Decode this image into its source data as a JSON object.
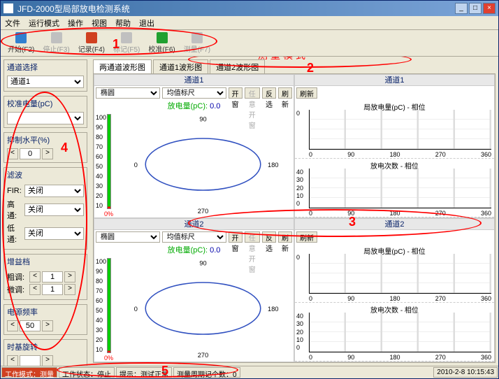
{
  "title": "JFD-2000型局部放电检测系统",
  "menu": [
    "文件",
    "运行模式",
    "操作",
    "视图",
    "帮助",
    "退出"
  ],
  "toolbar": [
    {
      "label": "开始(F2)",
      "color": "#3080d0",
      "disabled": false
    },
    {
      "label": "停止(F3)",
      "color": "#c0c0c0",
      "disabled": true
    },
    {
      "label": "记录(F4)",
      "color": "#d04020",
      "disabled": false
    },
    {
      "label": "标记(F5)",
      "color": "#c0c0c0",
      "disabled": true
    },
    {
      "label": "校准(F6)",
      "color": "#20a030",
      "disabled": false
    },
    {
      "label": "测量(F7)",
      "color": "#c0c0c0",
      "disabled": true
    }
  ],
  "sidebar": {
    "channel_sel": {
      "title": "通道选择",
      "value": "通道1"
    },
    "calib": {
      "title": "校准电量(pC)",
      "value": ""
    },
    "suppress": {
      "title": "抑制水平(%)",
      "value": "0"
    },
    "filter": {
      "title": "滤波",
      "fir_label": "FIR:",
      "fir_value": "关闭",
      "hp_label": "高通:",
      "hp_value": "关闭",
      "lp_label": "低通:",
      "lp_value": "关闭"
    },
    "gain": {
      "title": "增益档",
      "coarse_label": "粗调:",
      "coarse_value": "1",
      "fine_label": "微调:",
      "fine_value": "1"
    },
    "power": {
      "title": "电源频率",
      "value": "50"
    },
    "timebase": {
      "title": "时基旋转",
      "value": ""
    }
  },
  "tabs": [
    "两通道波形图",
    "通道1波形图",
    "通道2波形图"
  ],
  "quad": {
    "ch1": {
      "title": "通道1",
      "disp": "椭圆",
      "scale": "均值标尺",
      "open": "开窗",
      "anyopen": "任意开窗",
      "invert": "反选",
      "refresh": "刷新",
      "measure_label": "放电量(pC):",
      "measure_value": "0.0",
      "angles": [
        "90",
        "180",
        "270",
        "0"
      ]
    },
    "ch2": {
      "title": "通道2"
    },
    "right1": {
      "title": "通道1",
      "refresh": "刷新",
      "sub1": "局放电量(pC) - 相位",
      "sub2": "放电次数 - 相位"
    },
    "right2": {
      "title": "通道2"
    },
    "yticks": [
      "100",
      "90",
      "80",
      "70",
      "60",
      "50",
      "40",
      "30",
      "20",
      "10"
    ],
    "zero": "0%",
    "ry": [
      "0",
      "40",
      "30",
      "20",
      "10",
      "0"
    ],
    "rx": [
      "0",
      "90",
      "180",
      "270",
      "360"
    ]
  },
  "status": {
    "mode": "工作模式：测量",
    "state": "工作状态：停止",
    "hint": "提示：测试正常",
    "count": "测量周期记个数：0",
    "time": "2010-2-8 10:15:43"
  },
  "annot": {
    "mode_text": "测量模式",
    "n1": "1",
    "n2": "2",
    "n3": "3",
    "n4": "4",
    "n5": "5"
  }
}
